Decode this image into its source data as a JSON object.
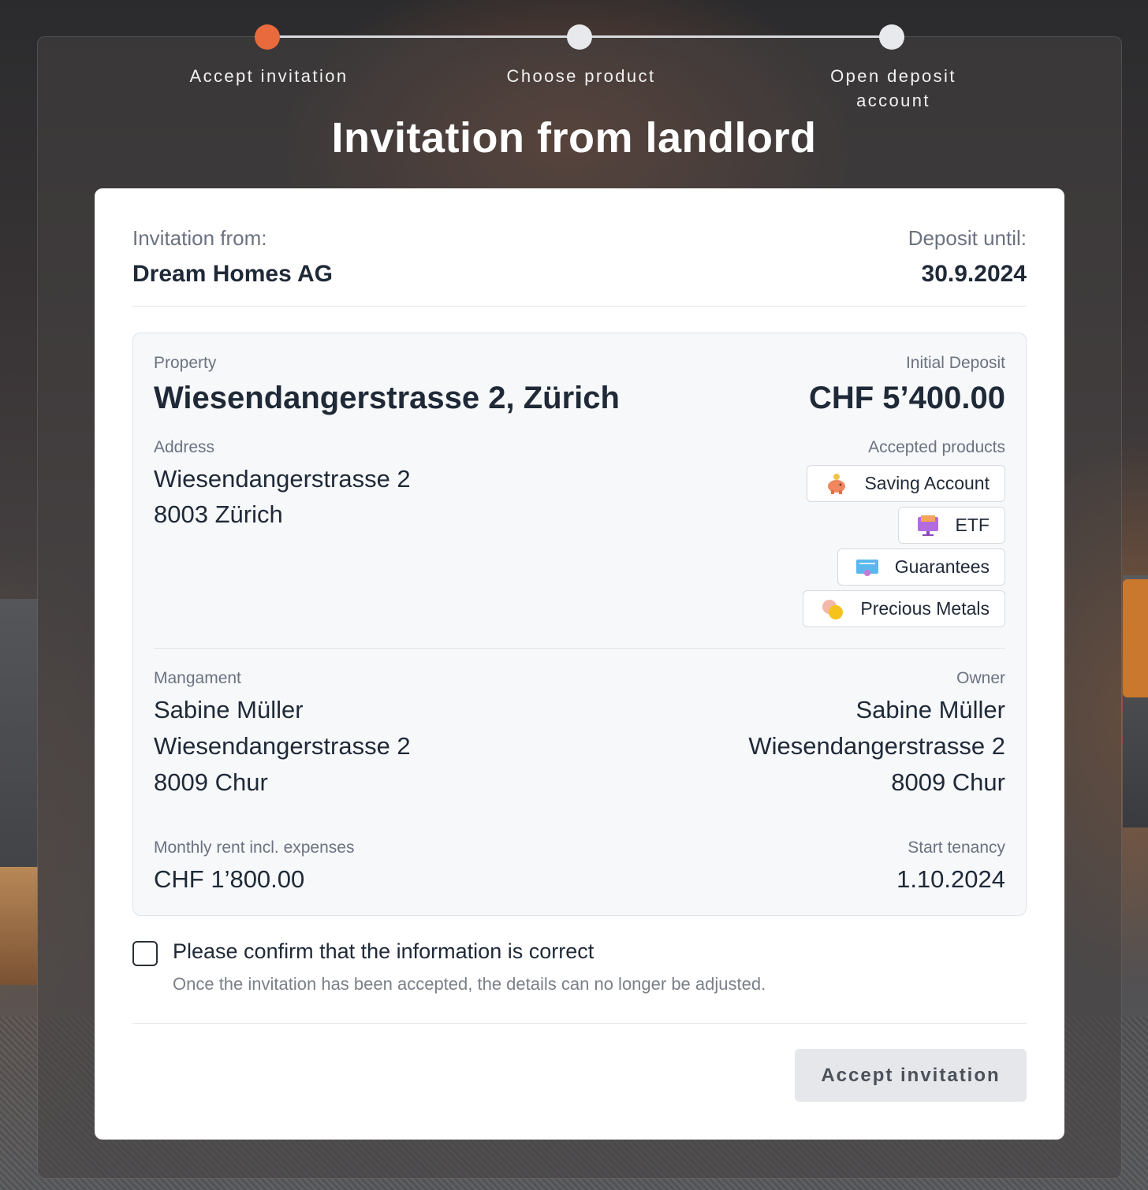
{
  "stepper": {
    "steps": [
      {
        "label": "Accept invitation",
        "state": "active"
      },
      {
        "label": "Choose product",
        "state": "upcoming"
      },
      {
        "label": "Open deposit account",
        "state": "upcoming"
      }
    ],
    "active_color": "#e96a3c"
  },
  "page_title": "Invitation from landlord",
  "invitation": {
    "from_label": "Invitation from:",
    "from_value": "Dream Homes AG",
    "deposit_until_label": "Deposit until:",
    "deposit_until_value": "30.9.2024"
  },
  "property": {
    "label": "Property",
    "name": "Wiesendangerstrasse 2, Zürich",
    "initial_deposit_label": "Initial Deposit",
    "initial_deposit_value": "CHF 5’400.00",
    "address_label": "Address",
    "address_line1": "Wiesendangerstrasse 2",
    "address_line2": "8003 Zürich",
    "accepted_products_label": "Accepted products",
    "products": [
      {
        "label": "Saving Account",
        "icon": "piggy-bank-icon"
      },
      {
        "label": "ETF",
        "icon": "monitor-chart-icon"
      },
      {
        "label": "Guarantees",
        "icon": "certificate-icon"
      },
      {
        "label": "Precious Metals",
        "icon": "coins-icon"
      }
    ]
  },
  "management": {
    "label": "Mangament",
    "name": "Sabine Müller",
    "street": "Wiesendangerstrasse 2",
    "city": "8009 Chur"
  },
  "owner": {
    "label": "Owner",
    "name": "Sabine Müller",
    "street": "Wiesendangerstrasse 2",
    "city": "8009 Chur"
  },
  "rent": {
    "label": "Monthly rent incl. expenses",
    "value": "CHF 1’800.00"
  },
  "tenancy": {
    "label": "Start tenancy",
    "value": "1.10.2024"
  },
  "confirmation": {
    "checked": false,
    "label": "Please confirm that the information is correct",
    "note": "Once the invitation has been accepted, the details can no longer be adjusted."
  },
  "accept_button": {
    "label": "Accept invitation",
    "enabled": false
  }
}
